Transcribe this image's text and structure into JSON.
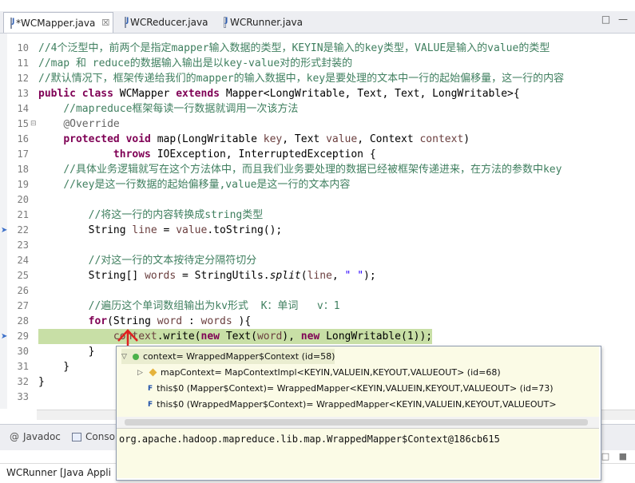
{
  "editor": {
    "tabs": [
      {
        "label": "*WCMapper.java",
        "close": "☒"
      },
      {
        "label": "WCReducer.java"
      },
      {
        "label": "WCRunner.java"
      }
    ],
    "window_controls": "□ —",
    "lines": [
      {
        "n": "10",
        "kind": "comment",
        "text": "//4个泛型中，前两个是指定mapper输入数据的类型，KEYIN是输入的key类型，VALUE是输入的value的类型"
      },
      {
        "n": "11",
        "kind": "comment",
        "text": "//map 和 reduce的数据输入输出是以key-value对的形式封装的"
      },
      {
        "n": "12",
        "kind": "comment",
        "text": "//默认情况下，框架传递给我们的mapper的输入数据中，key是要处理的文本中一行的起始偏移量，这一行的内容"
      },
      {
        "n": "13",
        "kind": "code",
        "parts": [
          [
            "kw",
            "public class "
          ],
          [
            "",
            "WCMapper "
          ],
          [
            "kw",
            "extends "
          ],
          [
            "",
            "Mapper<LongWritable, Text, Text, LongWritable>{"
          ]
        ]
      },
      {
        "n": "14",
        "kind": "comment",
        "indent": "    ",
        "text": "//mapreduce框架每读一行数据就调用一次该方法"
      },
      {
        "n": "15",
        "kind": "code",
        "parts": [
          [
            "",
            "    "
          ],
          [
            "an",
            "@Override"
          ]
        ]
      },
      {
        "n": "16",
        "kind": "code",
        "parts": [
          [
            "",
            "    "
          ],
          [
            "kw",
            "protected void "
          ],
          [
            "",
            "map(LongWritable "
          ],
          [
            "vr",
            "key"
          ],
          [
            "",
            ", Text "
          ],
          [
            "vr",
            "value"
          ],
          [
            "",
            ", Context "
          ],
          [
            "vr",
            "context"
          ],
          [
            "",
            ")"
          ]
        ]
      },
      {
        "n": "17",
        "kind": "code",
        "parts": [
          [
            "",
            "            "
          ],
          [
            "kw",
            "throws "
          ],
          [
            "",
            "IOException, InterruptedException {"
          ]
        ]
      },
      {
        "n": "18",
        "kind": "comment",
        "indent": "    ",
        "text": "//具体业务逻辑就写在这个方法体中，而且我们业务要处理的数据已经被框架传递进来，在方法的参数中key"
      },
      {
        "n": "19",
        "kind": "comment",
        "indent": "    ",
        "text": "//key是这一行数据的起始偏移量,value是这一行的文本内容"
      },
      {
        "n": "20",
        "kind": "code",
        "parts": [
          [
            "",
            ""
          ]
        ]
      },
      {
        "n": "21",
        "kind": "comment",
        "indent": "        ",
        "text": "//将这一行的内容转换成string类型"
      },
      {
        "n": "22",
        "kind": "code",
        "parts": [
          [
            "",
            "        String "
          ],
          [
            "vr",
            "line"
          ],
          [
            "",
            " = "
          ],
          [
            "vr",
            "value"
          ],
          [
            "",
            ".toString();"
          ]
        ]
      },
      {
        "n": "23",
        "kind": "code",
        "parts": [
          [
            "",
            ""
          ]
        ]
      },
      {
        "n": "24",
        "kind": "comment",
        "indent": "        ",
        "text": "//对这一行的文本按待定分隔符切分"
      },
      {
        "n": "25",
        "kind": "code",
        "parts": [
          [
            "",
            "        String[] "
          ],
          [
            "vr",
            "words"
          ],
          [
            "",
            " = StringUtils."
          ],
          [
            "it",
            "split"
          ],
          [
            "",
            "("
          ],
          [
            "vr",
            "line"
          ],
          [
            "",
            ", "
          ],
          [
            "st",
            "\" \""
          ],
          [
            "",
            ");"
          ]
        ]
      },
      {
        "n": "26",
        "kind": "code",
        "parts": [
          [
            "",
            ""
          ]
        ]
      },
      {
        "n": "27",
        "kind": "comment",
        "indent": "        ",
        "text": "//遍历这个单词数组输出为kv形式  K：单词   v：1"
      },
      {
        "n": "28",
        "kind": "code",
        "parts": [
          [
            "",
            "        "
          ],
          [
            "kw",
            "for"
          ],
          [
            "",
            "(String "
          ],
          [
            "vr",
            "word"
          ],
          [
            "",
            " : "
          ],
          [
            "vr",
            "words"
          ],
          [
            "",
            " ){"
          ]
        ]
      },
      {
        "n": "29",
        "kind": "code",
        "hl": true,
        "parts": [
          [
            "",
            "            "
          ],
          [
            "vr",
            "context"
          ],
          [
            "",
            ".write("
          ],
          [
            "kw",
            "new "
          ],
          [
            "",
            "Text("
          ],
          [
            "vr",
            "word"
          ],
          [
            "",
            "), "
          ],
          [
            "kw",
            "new "
          ],
          [
            "",
            "LongWritable(1));"
          ]
        ]
      },
      {
        "n": "30",
        "kind": "code",
        "parts": [
          [
            "",
            "        }"
          ]
        ]
      },
      {
        "n": "31",
        "kind": "code",
        "parts": [
          [
            "",
            "    }"
          ]
        ]
      },
      {
        "n": "32",
        "kind": "code",
        "parts": [
          [
            "",
            "}"
          ]
        ]
      },
      {
        "n": "33",
        "kind": "code",
        "parts": [
          [
            "",
            ""
          ]
        ]
      }
    ]
  },
  "hover": {
    "rows": [
      {
        "twisty": "▽",
        "icon": "field",
        "label": "context= WrappedMapper$Context  (id=58)",
        "selected": true
      },
      {
        "twisty": "▷",
        "icon": "diamond",
        "label": "mapContext= MapContextImpl<KEYIN,VALUEIN,KEYOUT,VALUEOUT>  (id=68)"
      },
      {
        "twisty": "",
        "icon": "final",
        "label": "this$0 (Mapper$Context)= WrappedMapper<KEYIN,VALUEIN,KEYOUT,VALUEOUT>  (id=73)"
      },
      {
        "twisty": "",
        "icon": "final",
        "label": "this$0 (WrappedMapper$Context)= WrappedMapper<KEYIN,VALUEIN,KEYOUT,VALUEOUT>"
      }
    ],
    "detail": "org.apache.hadoop.mapreduce.lib.map.WrappedMapper$Context@186cb615"
  },
  "bottom": {
    "tabs": [
      {
        "label": "Javadoc",
        "prefix": "@"
      },
      {
        "label": "Conso"
      }
    ],
    "toolbar": "▣ ▼ □ ■",
    "status": "WCRunner [Java Appli"
  },
  "colors": {
    "keyword": "#7f0055",
    "comment": "#3f7f5f",
    "variable": "#6a3e3e",
    "highlight": "#c8dfa6",
    "arrow": "#e02020"
  }
}
